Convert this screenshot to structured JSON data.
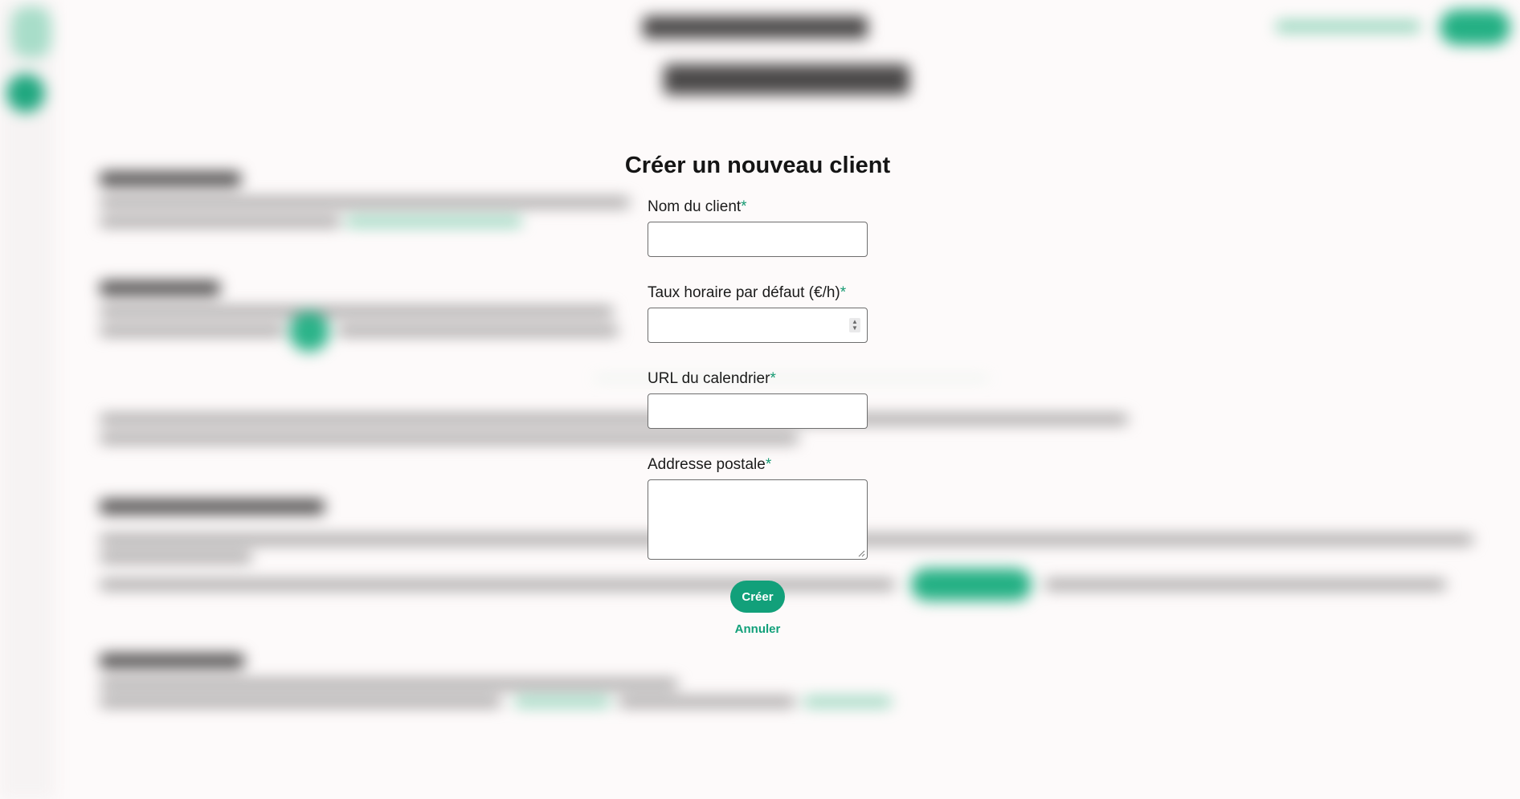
{
  "modal": {
    "title": "Créer un nouveau client",
    "required_marker": "*",
    "fields": {
      "client_name": {
        "label": "Nom du client",
        "value": ""
      },
      "hourly_rate": {
        "label": "Taux horaire par défaut (€/h)",
        "value": ""
      },
      "calendar_url": {
        "label": "URL du calendrier",
        "value": ""
      },
      "postal_address": {
        "label": "Addresse postale",
        "value": ""
      }
    },
    "submit_label": "Créer",
    "cancel_label": "Annuler"
  },
  "colors": {
    "accent": "#12a07a",
    "background": "#fdfafa",
    "text": "#151515"
  },
  "icons": {
    "number_spinner": "spinner-arrows-icon",
    "textarea_resize": "resize-grip-icon"
  }
}
